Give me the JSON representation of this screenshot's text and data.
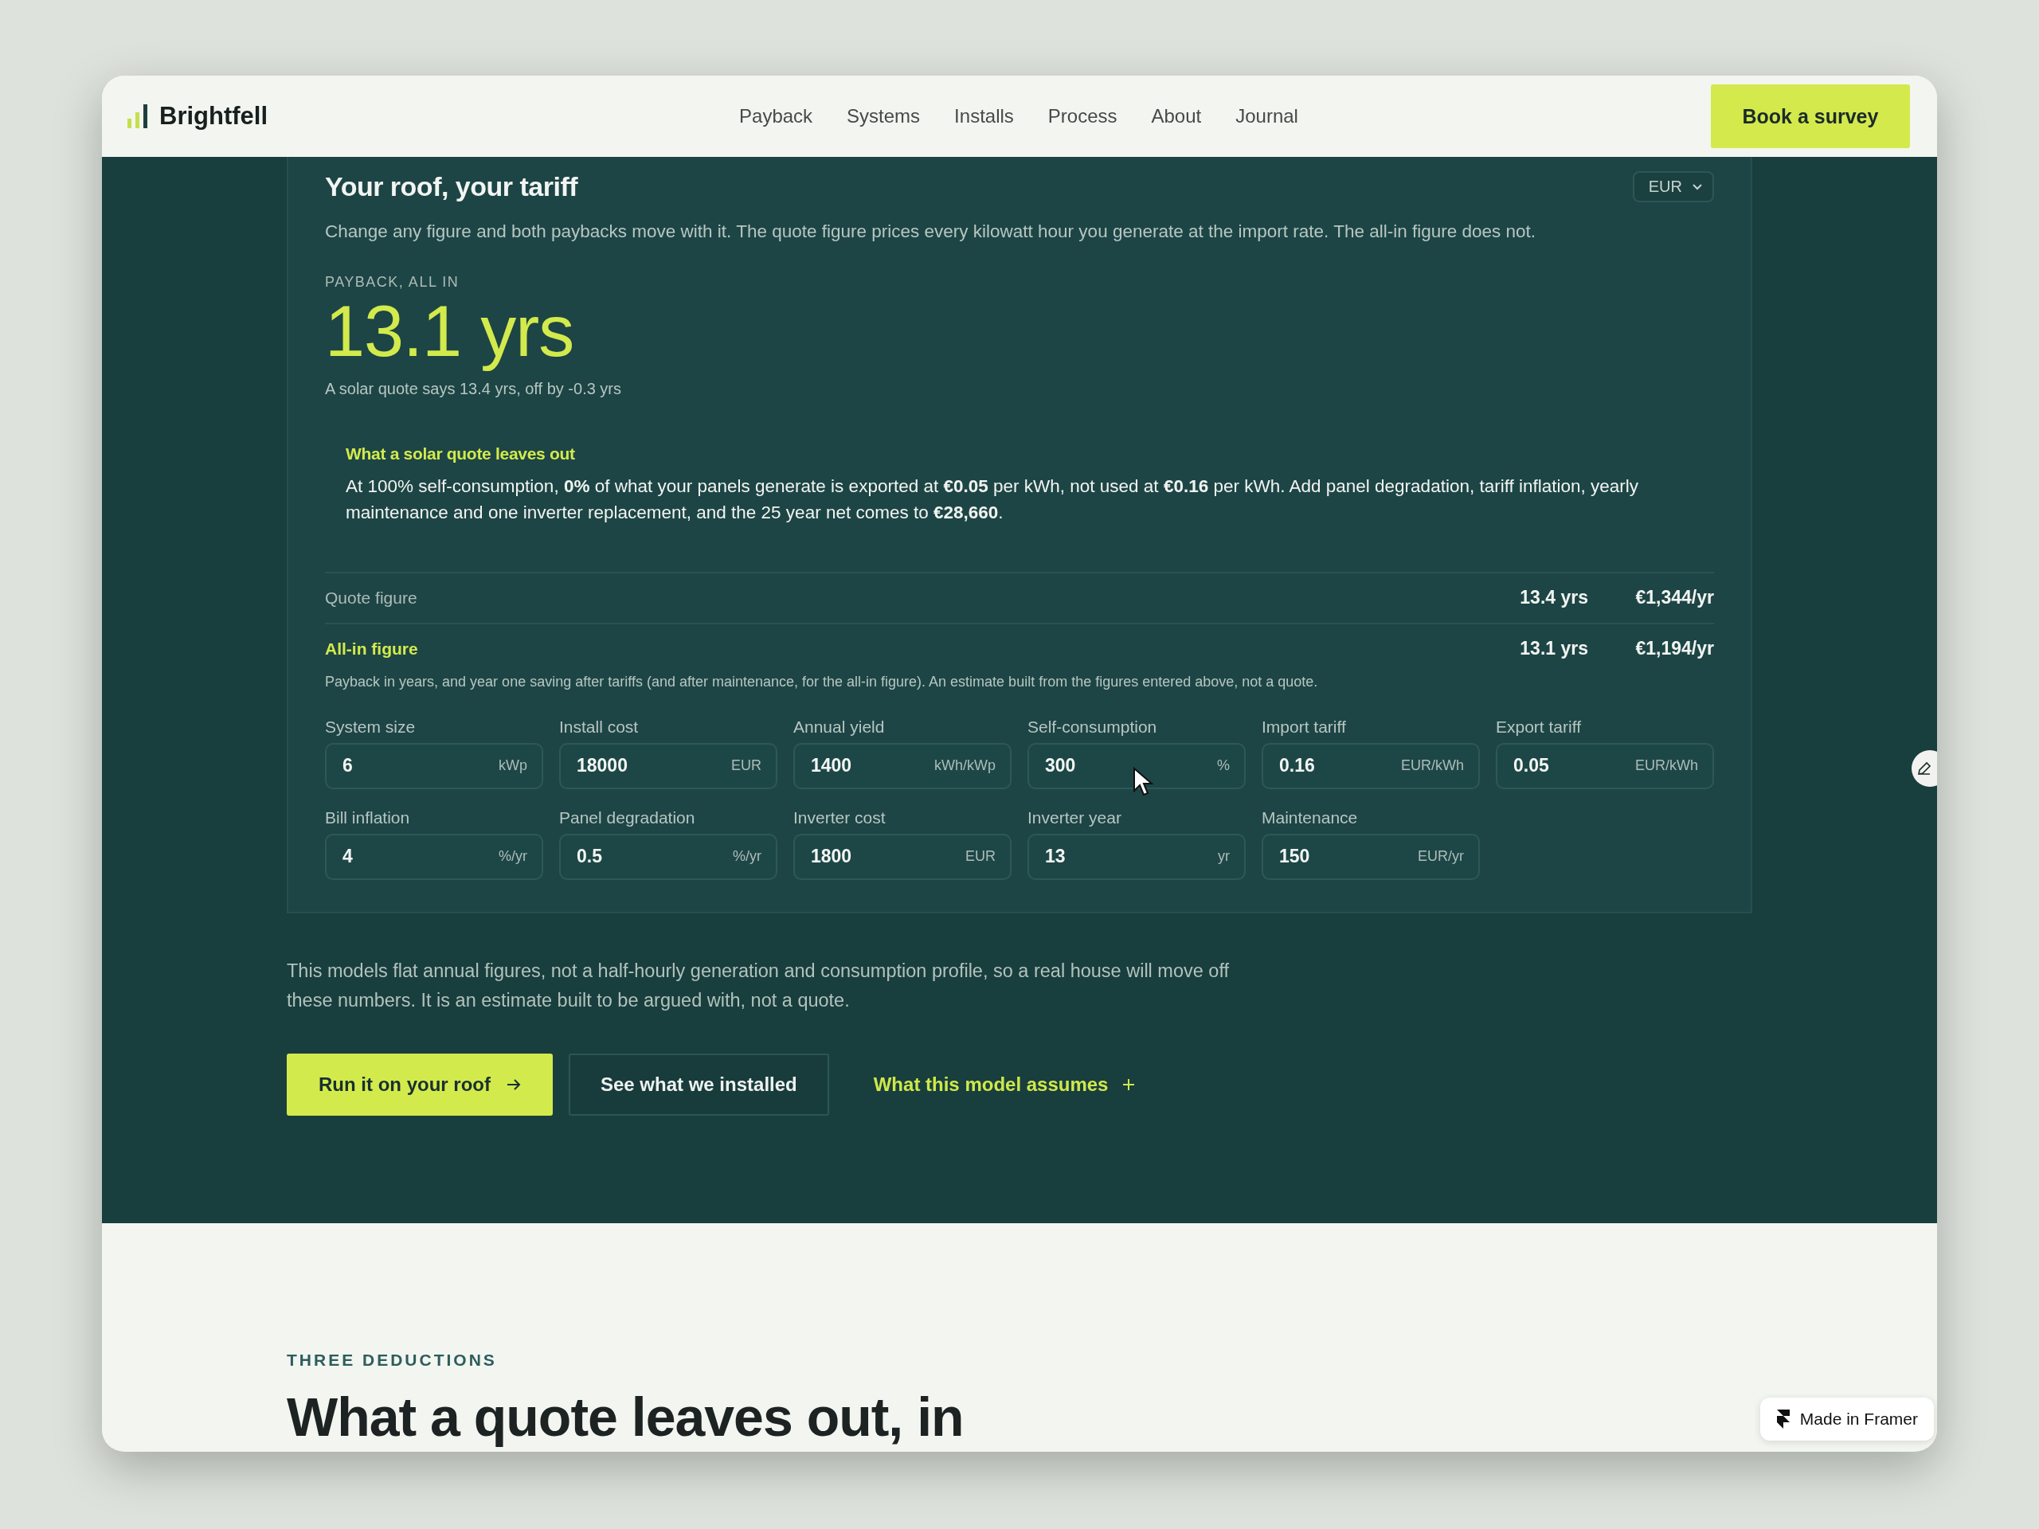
{
  "header": {
    "brand": "Brightfell",
    "nav": [
      "Payback",
      "Systems",
      "Installs",
      "Process",
      "About",
      "Journal"
    ],
    "cta": "Book a survey"
  },
  "calculator": {
    "title": "Your roof, your tariff",
    "currency": "EUR",
    "description": "Change any figure and both paybacks move with it. The quote figure prices every kilowatt hour you generate at the import rate. The all-in figure does not.",
    "payback_label": "PAYBACK, ALL IN",
    "payback_value": "13.1 yrs",
    "payback_note": "A solar quote says 13.4 yrs, off by -0.3 yrs",
    "callout": {
      "title": "What a solar quote leaves out",
      "text": "At 100% self-consumption, **0%** of what your panels generate is exported at **€0.05** per kWh, not used at **€0.16** per kWh. Add panel degradation, tariff inflation, yearly maintenance and one inverter replacement, and the 25 year net comes to **€28,660**."
    },
    "rows": [
      {
        "label": "Quote figure",
        "years": "13.4 yrs",
        "saving": "€1,344/yr",
        "highlighted": false
      },
      {
        "label": "All-in figure",
        "years": "13.1 yrs",
        "saving": "€1,194/yr",
        "highlighted": true
      }
    ],
    "rows_note": "Payback in years, and year one saving after tariffs (and after maintenance, for the all-in figure). An estimate built from the figures entered above, not a quote.",
    "fields": [
      {
        "label": "System size",
        "value": "6",
        "unit": "kWp"
      },
      {
        "label": "Install cost",
        "value": "18000",
        "unit": "EUR"
      },
      {
        "label": "Annual yield",
        "value": "1400",
        "unit": "kWh/kWp"
      },
      {
        "label": "Self-consumption",
        "value": "300",
        "unit": "%"
      },
      {
        "label": "Import tariff",
        "value": "0.16",
        "unit": "EUR/kWh"
      },
      {
        "label": "Export tariff",
        "value": "0.05",
        "unit": "EUR/kWh"
      },
      {
        "label": "Bill inflation",
        "value": "4",
        "unit": "%/yr"
      },
      {
        "label": "Panel degradation",
        "value": "0.5",
        "unit": "%/yr"
      },
      {
        "label": "Inverter cost",
        "value": "1800",
        "unit": "EUR"
      },
      {
        "label": "Inverter year",
        "value": "13",
        "unit": "yr"
      },
      {
        "label": "Maintenance",
        "value": "150",
        "unit": "EUR/yr"
      }
    ]
  },
  "note": "This models flat annual figures, not a half-hourly generation and consumption profile, so a real house will move off these numbers. It is an estimate built to be argued with, not a quote.",
  "actions": [
    {
      "label": "Run it on your roof",
      "kind": "primary"
    },
    {
      "label": "See what we installed",
      "kind": "secondary"
    },
    {
      "label": "What this model assumes",
      "kind": "link"
    }
  ],
  "section": {
    "eyebrow": "THREE DEDUCTIONS",
    "heading": "What a quote leaves out, in"
  },
  "badge": "Made in Framer"
}
